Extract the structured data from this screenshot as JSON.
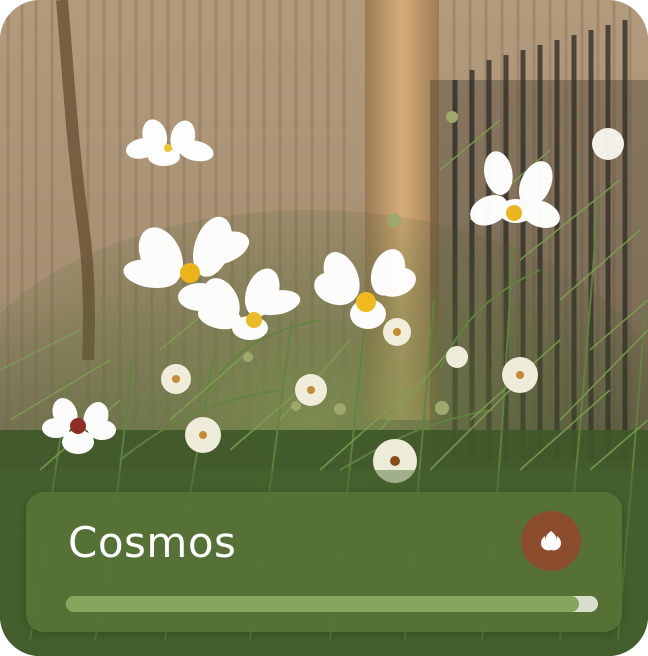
{
  "card": {
    "title": "Cosmos",
    "icon": "flower-bud-icon",
    "progress": 0.965,
    "colors": {
      "overlay": "#587337",
      "icon_bg": "#8b4d2b",
      "progress_fill": "#87a55d",
      "progress_track": "#d9dfcf"
    }
  }
}
